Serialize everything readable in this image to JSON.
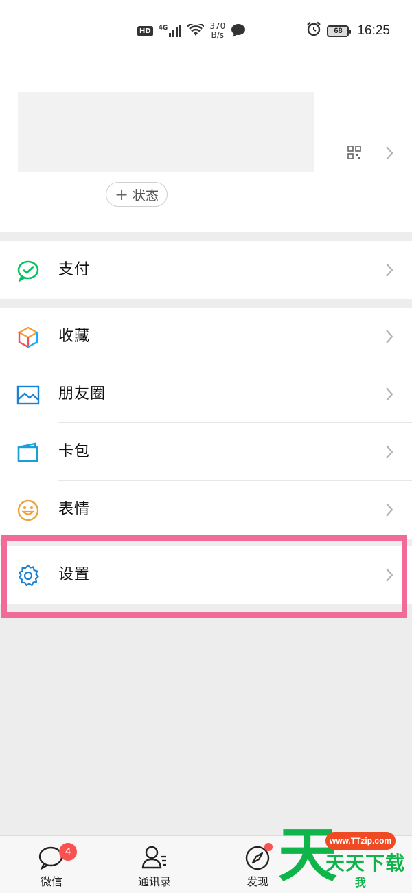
{
  "status_bar": {
    "hd": "HD",
    "network": "4G",
    "speed_value": "370",
    "speed_unit": "B/s",
    "battery": "68",
    "time": "16:25"
  },
  "profile": {
    "status_button_plus": "+",
    "status_button_label": "状态"
  },
  "menu": {
    "pay": "支付",
    "favorites": "收藏",
    "moments": "朋友圈",
    "cards": "卡包",
    "stickers": "表情",
    "settings": "设置"
  },
  "tabbar": {
    "chats": "微信",
    "chats_badge": "4",
    "contacts": "通讯录",
    "discover": "发现",
    "me": "我"
  },
  "watermark": {
    "big": "天",
    "url": "www.TTzip.com",
    "text": "天天下载"
  },
  "colors": {
    "highlight": "#f06c97",
    "wechat_green": "#07c160",
    "badge_red": "#fa5151",
    "watermark_green": "#0fb44a"
  }
}
